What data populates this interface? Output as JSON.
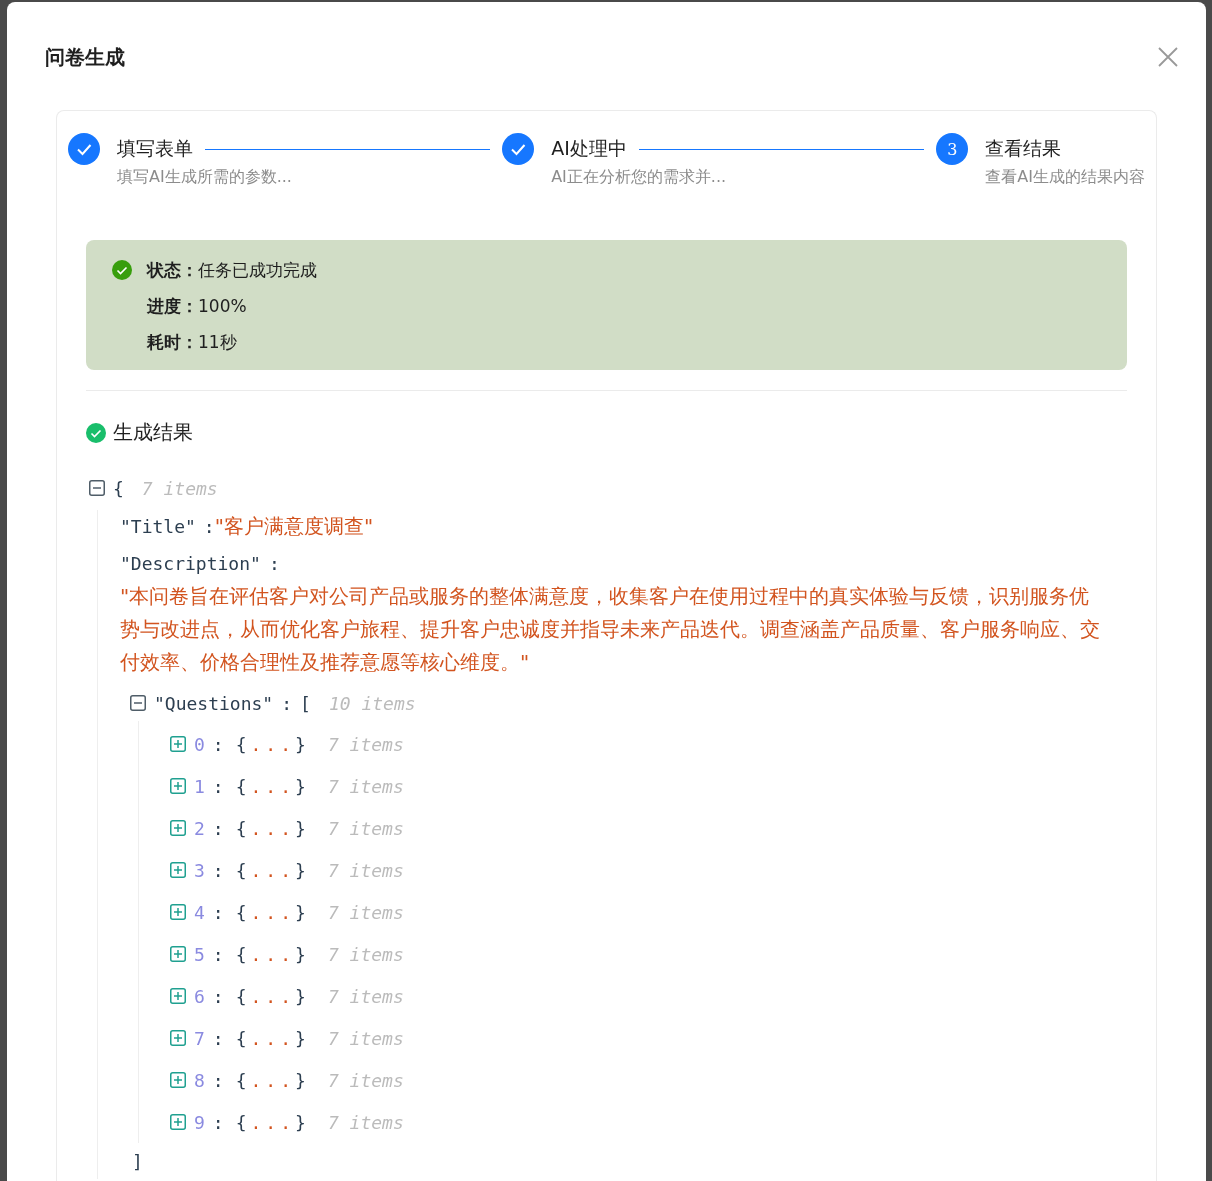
{
  "dialog": {
    "title": "问卷生成"
  },
  "steps": [
    {
      "title": "填写表单",
      "description": "填写AI生成所需的参数...",
      "completed": true
    },
    {
      "title": "AI处理中",
      "description": "AI正在分析您的需求并...",
      "completed": true
    },
    {
      "number": "3",
      "title": "查看结果",
      "description": "查看AI生成的结果内容",
      "completed": false
    }
  ],
  "status_panel": {
    "rows": [
      {
        "label": "状态：",
        "value": "任务已成功完成"
      },
      {
        "label": "进度：",
        "value": "100%"
      },
      {
        "label": "耗时：",
        "value": "11秒"
      }
    ]
  },
  "result": {
    "heading": "生成结果",
    "tree": {
      "expanded": true,
      "open": "{",
      "count": "7 items",
      "entries": [
        {
          "kind": "string",
          "key": "\"Title\"",
          "sep": ":",
          "value": "\"客户满意度调查\""
        },
        {
          "kind": "string",
          "key": "\"Description\"",
          "sep": ":",
          "value": "\"本问卷旨在评估客户对公司产品或服务的整体满意度，收集客户在使用过程中的真实体验与反馈，识别服务优势与改进点，从而优化客户旅程、提升客户忠诚度并指导未来产品迭代。调查涵盖产品质量、客户服务响应、交付效率、价格合理性及推荐意愿等核心维度。\""
        },
        {
          "kind": "array",
          "key": "\"Questions\"",
          "sep": ":",
          "expanded": true,
          "open": "[",
          "count": "10 items",
          "close": "]",
          "children": [
            {
              "key": "0",
              "sep": ":",
              "expanded": false,
              "preview": "{...}",
              "count": "7 items"
            },
            {
              "key": "1",
              "sep": ":",
              "expanded": false,
              "preview": "{...}",
              "count": "7 items"
            },
            {
              "key": "2",
              "sep": ":",
              "expanded": false,
              "preview": "{...}",
              "count": "7 items"
            },
            {
              "key": "3",
              "sep": ":",
              "expanded": false,
              "preview": "{...}",
              "count": "7 items"
            },
            {
              "key": "4",
              "sep": ":",
              "expanded": false,
              "preview": "{...}",
              "count": "7 items"
            },
            {
              "key": "5",
              "sep": ":",
              "expanded": false,
              "preview": "{...}",
              "count": "7 items"
            },
            {
              "key": "6",
              "sep": ":",
              "expanded": false,
              "preview": "{...}",
              "count": "7 items"
            },
            {
              "key": "7",
              "sep": ":",
              "expanded": false,
              "preview": "{...}",
              "count": "7 items"
            },
            {
              "key": "8",
              "sep": ":",
              "expanded": false,
              "preview": "{...}",
              "count": "7 items"
            },
            {
              "key": "9",
              "sep": ":",
              "expanded": false,
              "preview": "{...}",
              "count": "7 items"
            }
          ]
        }
      ]
    }
  }
}
